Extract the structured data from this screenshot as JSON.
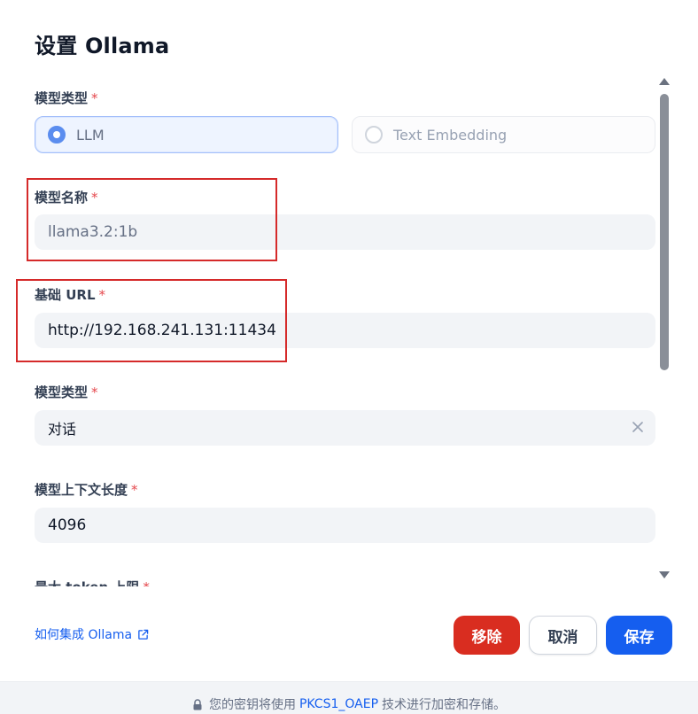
{
  "dialog": {
    "title": "设置 Ollama"
  },
  "form": {
    "model_type": {
      "label": "模型类型",
      "required_mark": "*",
      "options": [
        {
          "label": "LLM",
          "selected": true
        },
        {
          "label": "Text Embedding",
          "selected": false
        }
      ]
    },
    "model_name": {
      "label": "模型名称",
      "required_mark": "*",
      "value": "llama3.2:1b"
    },
    "base_url": {
      "label": "基础 URL",
      "required_mark": "*",
      "value": "http://192.168.241.131:11434"
    },
    "completion_mode": {
      "label": "模型类型",
      "required_mark": "*",
      "value": "对话",
      "clear_icon": "close-icon"
    },
    "context_length": {
      "label": "模型上下文长度",
      "required_mark": "*",
      "value": "4096"
    },
    "max_tokens": {
      "label": "最大 token 上限",
      "required_mark": "*"
    }
  },
  "actions": {
    "help_link": "如何集成 Ollama",
    "remove_label": "移除",
    "cancel_label": "取消",
    "save_label": "保存"
  },
  "footer": {
    "text_before": "您的密钥将使用",
    "accent_text": "PKCS1_OAEP",
    "text_after": "技术进行加密和存储。"
  },
  "colors": {
    "primary": "#155eef",
    "danger": "#d92d20",
    "highlight_box": "#d52a2a",
    "required": "#e5484d"
  }
}
